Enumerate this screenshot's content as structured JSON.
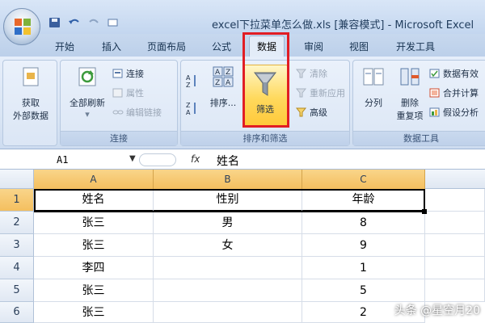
{
  "window": {
    "title": "excel下拉菜单怎么做.xls  [兼容模式] - Microsoft Excel"
  },
  "tabs": [
    "开始",
    "插入",
    "页面布局",
    "公式",
    "数据",
    "审阅",
    "视图",
    "开发工具"
  ],
  "active_tab": "数据",
  "ribbon": {
    "get_external": {
      "line1": "获取",
      "line2": "外部数据"
    },
    "refresh_all": "全部刷新",
    "connections": {
      "connect": "连接",
      "properties": "属性",
      "edit_links": "编辑链接",
      "label": "连接"
    },
    "sort_filter": {
      "sort": "排序...",
      "filter": "筛选",
      "clear": "清除",
      "reapply": "重新应用",
      "advanced": "高级",
      "label": "排序和筛选"
    },
    "data_tools": {
      "split": "分列",
      "remove_dup_1": "删除",
      "remove_dup_2": "重复项",
      "validation": "数据有效",
      "consolidate": "合并计算",
      "whatif": "假设分析",
      "label": "数据工具"
    }
  },
  "formula_bar": {
    "name_box": "A1",
    "fx": "fx",
    "value": "姓名"
  },
  "sheet": {
    "columns": [
      "A",
      "B",
      "C"
    ],
    "rows": [
      "1",
      "2",
      "3",
      "4",
      "5",
      "6"
    ],
    "cells": [
      [
        "姓名",
        "性别",
        "年龄"
      ],
      [
        "张三",
        "男",
        "8"
      ],
      [
        "张三",
        "女",
        "9"
      ],
      [
        "李四",
        "",
        "1"
      ],
      [
        "张三",
        "",
        "5"
      ],
      [
        "张三",
        "",
        "2"
      ]
    ]
  },
  "watermark": "头条 @星空月20",
  "colors": {
    "highlight": "#e11d24",
    "col_header": "#f4bf5f",
    "filter_active": "#ffd95c"
  }
}
